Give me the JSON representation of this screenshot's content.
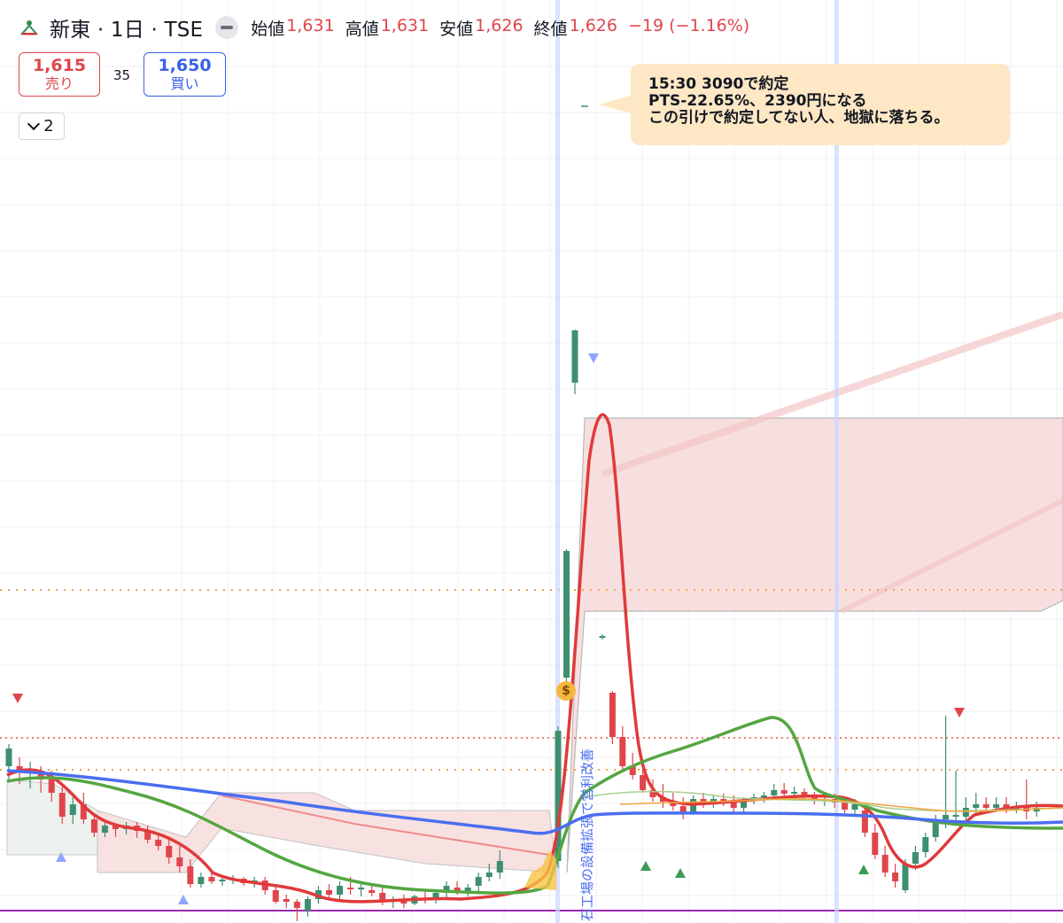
{
  "header": {
    "title": "新東 · 1日 · TSE",
    "ohlc": [
      {
        "label": "始値",
        "value": "1,631"
      },
      {
        "label": "高値",
        "value": "1,631"
      },
      {
        "label": "安値",
        "value": "1,626"
      },
      {
        "label": "終値",
        "value": "1,626"
      }
    ],
    "change": "−19 (−1.16%)"
  },
  "trade": {
    "sell_price": "1,615",
    "sell_label": "売り",
    "spread": "35",
    "buy_price": "1,650",
    "buy_label": "買い"
  },
  "indicator_toggle": {
    "count": "2"
  },
  "annotation": {
    "lines": [
      "15:30 3090で約定",
      "PTS-22.65%、2390円になる",
      "この引けで約定してない人、地獄に落ちる。"
    ]
  },
  "event_label": "石工場の設備拡張で営利改善",
  "colors": {
    "up": "#3d8f6f",
    "down": "#e0454b",
    "ma_fast": "#e03a3a",
    "ma_mid": "#55a641",
    "ma_slow": "#4a6ef0",
    "cloud": "#f6d7d7",
    "level": "#f3a33b",
    "level_red": "#e05252",
    "baseline": "#9c27b0"
  },
  "chart_data": {
    "type": "candlestick",
    "symbol": "新東",
    "interval": "1日",
    "exchange": "TSE",
    "last_bar": {
      "open": 1631,
      "high": 1631,
      "low": 1626,
      "close": 1626
    },
    "change": -19,
    "change_pct": -1.16,
    "bid": 1615,
    "ask": 1650,
    "spread": 35,
    "candles_pixel_read": [
      {
        "o": 845,
        "h": 840,
        "l": 880,
        "c": 865,
        "dir": "up"
      },
      {
        "o": 865,
        "h": 855,
        "l": 885,
        "c": 870,
        "dir": "down"
      },
      {
        "o": 870,
        "h": 860,
        "l": 890,
        "c": 868,
        "dir": "up"
      },
      {
        "o": 870,
        "h": 865,
        "l": 895,
        "c": 880,
        "dir": "down"
      },
      {
        "o": 880,
        "h": 870,
        "l": 905,
        "c": 895,
        "dir": "down"
      },
      {
        "o": 895,
        "h": 885,
        "l": 930,
        "c": 922,
        "dir": "down"
      },
      {
        "o": 920,
        "h": 900,
        "l": 930,
        "c": 908,
        "dir": "up"
      },
      {
        "o": 908,
        "h": 895,
        "l": 930,
        "c": 925,
        "dir": "down"
      },
      {
        "o": 925,
        "h": 920,
        "l": 945,
        "c": 940,
        "dir": "down"
      },
      {
        "o": 940,
        "h": 928,
        "l": 945,
        "c": 932,
        "dir": "up"
      },
      {
        "o": 932,
        "h": 930,
        "l": 945,
        "c": 936,
        "dir": "down"
      },
      {
        "o": 936,
        "h": 928,
        "l": 942,
        "c": 932,
        "dir": "up"
      },
      {
        "o": 932,
        "h": 928,
        "l": 946,
        "c": 938,
        "dir": "down"
      },
      {
        "o": 938,
        "h": 932,
        "l": 952,
        "c": 948,
        "dir": "down"
      },
      {
        "o": 948,
        "h": 940,
        "l": 960,
        "c": 955,
        "dir": "down"
      },
      {
        "o": 955,
        "h": 948,
        "l": 975,
        "c": 968,
        "dir": "down"
      },
      {
        "o": 968,
        "h": 955,
        "l": 985,
        "c": 978,
        "dir": "down"
      },
      {
        "o": 978,
        "h": 970,
        "l": 1002,
        "c": 998,
        "dir": "down"
      },
      {
        "o": 998,
        "h": 985,
        "l": 1002,
        "c": 990,
        "dir": "up"
      },
      {
        "o": 990,
        "h": 985,
        "l": 998,
        "c": 995,
        "dir": "down"
      },
      {
        "o": 995,
        "h": 990,
        "l": 1000,
        "c": 993,
        "dir": "up"
      },
      {
        "o": 993,
        "h": 988,
        "l": 998,
        "c": 992,
        "dir": "up"
      },
      {
        "o": 992,
        "h": 990,
        "l": 1000,
        "c": 997,
        "dir": "down"
      },
      {
        "o": 997,
        "h": 990,
        "l": 1002,
        "c": 994,
        "dir": "up"
      },
      {
        "o": 994,
        "h": 990,
        "l": 1010,
        "c": 1005,
        "dir": "down"
      },
      {
        "o": 1005,
        "h": 1000,
        "l": 1020,
        "c": 1018,
        "dir": "down"
      },
      {
        "o": 1018,
        "h": 1010,
        "l": 1025,
        "c": 1015,
        "dir": "down"
      },
      {
        "o": 1018,
        "h": 1015,
        "l": 1040,
        "c": 1025,
        "dir": "down"
      },
      {
        "o": 1028,
        "h": 1012,
        "l": 1035,
        "c": 1015,
        "dir": "up"
      },
      {
        "o": 1015,
        "h": 1000,
        "l": 1020,
        "c": 1005,
        "dir": "up"
      },
      {
        "o": 1005,
        "h": 998,
        "l": 1015,
        "c": 1010,
        "dir": "down"
      },
      {
        "o": 1010,
        "h": 995,
        "l": 1015,
        "c": 1000,
        "dir": "up"
      },
      {
        "o": 1002,
        "h": 990,
        "l": 1010,
        "c": 1004,
        "dir": "down"
      },
      {
        "o": 1004,
        "h": 995,
        "l": 1012,
        "c": 1002,
        "dir": "up"
      },
      {
        "o": 1005,
        "h": 998,
        "l": 1012,
        "c": 1008,
        "dir": "down"
      },
      {
        "o": 1008,
        "h": 1000,
        "l": 1022,
        "c": 1018,
        "dir": "down"
      },
      {
        "o": 1018,
        "h": 1012,
        "l": 1025,
        "c": 1016,
        "dir": "up"
      },
      {
        "o": 1016,
        "h": 1010,
        "l": 1025,
        "c": 1020,
        "dir": "down"
      },
      {
        "o": 1020,
        "h": 1010,
        "l": 1022,
        "c": 1012,
        "dir": "up"
      },
      {
        "o": 1014,
        "h": 1006,
        "l": 1020,
        "c": 1016,
        "dir": "down"
      },
      {
        "o": 1016,
        "h": 1005,
        "l": 1020,
        "c": 1008,
        "dir": "up"
      },
      {
        "o": 1008,
        "h": 995,
        "l": 1015,
        "c": 1000,
        "dir": "up"
      },
      {
        "o": 1002,
        "h": 995,
        "l": 1010,
        "c": 1006,
        "dir": "down"
      },
      {
        "o": 1006,
        "h": 998,
        "l": 1012,
        "c": 1002,
        "dir": "up"
      },
      {
        "o": 1000,
        "h": 985,
        "l": 1006,
        "c": 990,
        "dir": "up"
      },
      {
        "o": 990,
        "h": 975,
        "l": 995,
        "c": 985,
        "dir": "up"
      },
      {
        "o": 985,
        "h": 960,
        "l": 992,
        "c": 972,
        "dir": "up"
      },
      {
        "o": 972,
        "h": 820,
        "l": 980,
        "c": 825,
        "dir": "up"
      },
      {
        "o": 765,
        "h": 620,
        "l": 775,
        "c": 622,
        "dir": "up"
      },
      {
        "o": 432,
        "h": 372,
        "l": 445,
        "c": 373,
        "dir": "up"
      },
      {
        "o": 720,
        "h": 716,
        "l": 722,
        "c": 718,
        "dir": "doji"
      },
      {
        "o": 782,
        "h": 780,
        "l": 840,
        "c": 832,
        "dir": "down"
      },
      {
        "o": 832,
        "h": 820,
        "l": 870,
        "c": 865,
        "dir": "down"
      },
      {
        "o": 865,
        "h": 850,
        "l": 880,
        "c": 875,
        "dir": "down"
      },
      {
        "o": 875,
        "h": 860,
        "l": 895,
        "c": 892,
        "dir": "down"
      },
      {
        "o": 892,
        "h": 880,
        "l": 905,
        "c": 900,
        "dir": "down"
      },
      {
        "o": 900,
        "h": 885,
        "l": 912,
        "c": 905,
        "dir": "down"
      },
      {
        "o": 905,
        "h": 895,
        "l": 915,
        "c": 910,
        "dir": "down"
      },
      {
        "o": 910,
        "h": 900,
        "l": 925,
        "c": 918,
        "dir": "down"
      },
      {
        "o": 918,
        "h": 898,
        "l": 920,
        "c": 902,
        "dir": "up"
      },
      {
        "o": 902,
        "h": 895,
        "l": 912,
        "c": 908,
        "dir": "down"
      },
      {
        "o": 908,
        "h": 898,
        "l": 912,
        "c": 902,
        "dir": "up"
      },
      {
        "o": 902,
        "h": 896,
        "l": 910,
        "c": 906,
        "dir": "down"
      },
      {
        "o": 906,
        "h": 898,
        "l": 918,
        "c": 912,
        "dir": "down"
      },
      {
        "o": 912,
        "h": 900,
        "l": 918,
        "c": 904,
        "dir": "up"
      },
      {
        "o": 904,
        "h": 896,
        "l": 908,
        "c": 900,
        "dir": "up"
      },
      {
        "o": 900,
        "h": 894,
        "l": 906,
        "c": 898,
        "dir": "up"
      },
      {
        "o": 898,
        "h": 885,
        "l": 902,
        "c": 892,
        "dir": "up"
      },
      {
        "o": 892,
        "h": 884,
        "l": 900,
        "c": 896,
        "dir": "down"
      },
      {
        "o": 896,
        "h": 888,
        "l": 902,
        "c": 894,
        "dir": "up"
      },
      {
        "o": 894,
        "h": 890,
        "l": 904,
        "c": 900,
        "dir": "down"
      },
      {
        "o": 900,
        "h": 894,
        "l": 908,
        "c": 904,
        "dir": "down"
      },
      {
        "o": 904,
        "h": 896,
        "l": 910,
        "c": 902,
        "dir": "up"
      },
      {
        "o": 902,
        "h": 896,
        "l": 912,
        "c": 906,
        "dir": "down"
      },
      {
        "o": 906,
        "h": 900,
        "l": 918,
        "c": 914,
        "dir": "down"
      },
      {
        "o": 914,
        "h": 902,
        "l": 920,
        "c": 908,
        "dir": "up"
      },
      {
        "o": 915,
        "h": 908,
        "l": 945,
        "c": 940,
        "dir": "down"
      },
      {
        "o": 940,
        "h": 930,
        "l": 970,
        "c": 965,
        "dir": "down"
      },
      {
        "o": 965,
        "h": 955,
        "l": 990,
        "c": 985,
        "dir": "down"
      },
      {
        "o": 985,
        "h": 975,
        "l": 1002,
        "c": 995,
        "dir": "down"
      },
      {
        "o": 1005,
        "h": 970,
        "l": 1008,
        "c": 975,
        "dir": "up"
      },
      {
        "o": 975,
        "h": 955,
        "l": 982,
        "c": 962,
        "dir": "up"
      },
      {
        "o": 962,
        "h": 940,
        "l": 968,
        "c": 945,
        "dir": "up"
      },
      {
        "o": 945,
        "h": 920,
        "l": 950,
        "c": 925,
        "dir": "up"
      },
      {
        "o": 925,
        "h": 808,
        "l": 935,
        "c": 920,
        "dir": "up"
      },
      {
        "o": 920,
        "h": 870,
        "l": 930,
        "c": 922,
        "dir": "up"
      },
      {
        "o": 922,
        "h": 900,
        "l": 928,
        "c": 912,
        "dir": "up"
      },
      {
        "o": 912,
        "h": 895,
        "l": 918,
        "c": 908,
        "dir": "up"
      },
      {
        "o": 908,
        "h": 900,
        "l": 918,
        "c": 912,
        "dir": "down"
      },
      {
        "o": 912,
        "h": 900,
        "l": 916,
        "c": 908,
        "dir": "up"
      },
      {
        "o": 908,
        "h": 900,
        "l": 918,
        "c": 914,
        "dir": "down"
      },
      {
        "o": 914,
        "h": 905,
        "l": 918,
        "c": 910,
        "dir": "up"
      },
      {
        "o": 910,
        "h": 880,
        "l": 925,
        "c": 916,
        "dir": "down"
      },
      {
        "o": 916,
        "h": 905,
        "l": 922,
        "c": 912,
        "dir": "up"
      }
    ]
  }
}
